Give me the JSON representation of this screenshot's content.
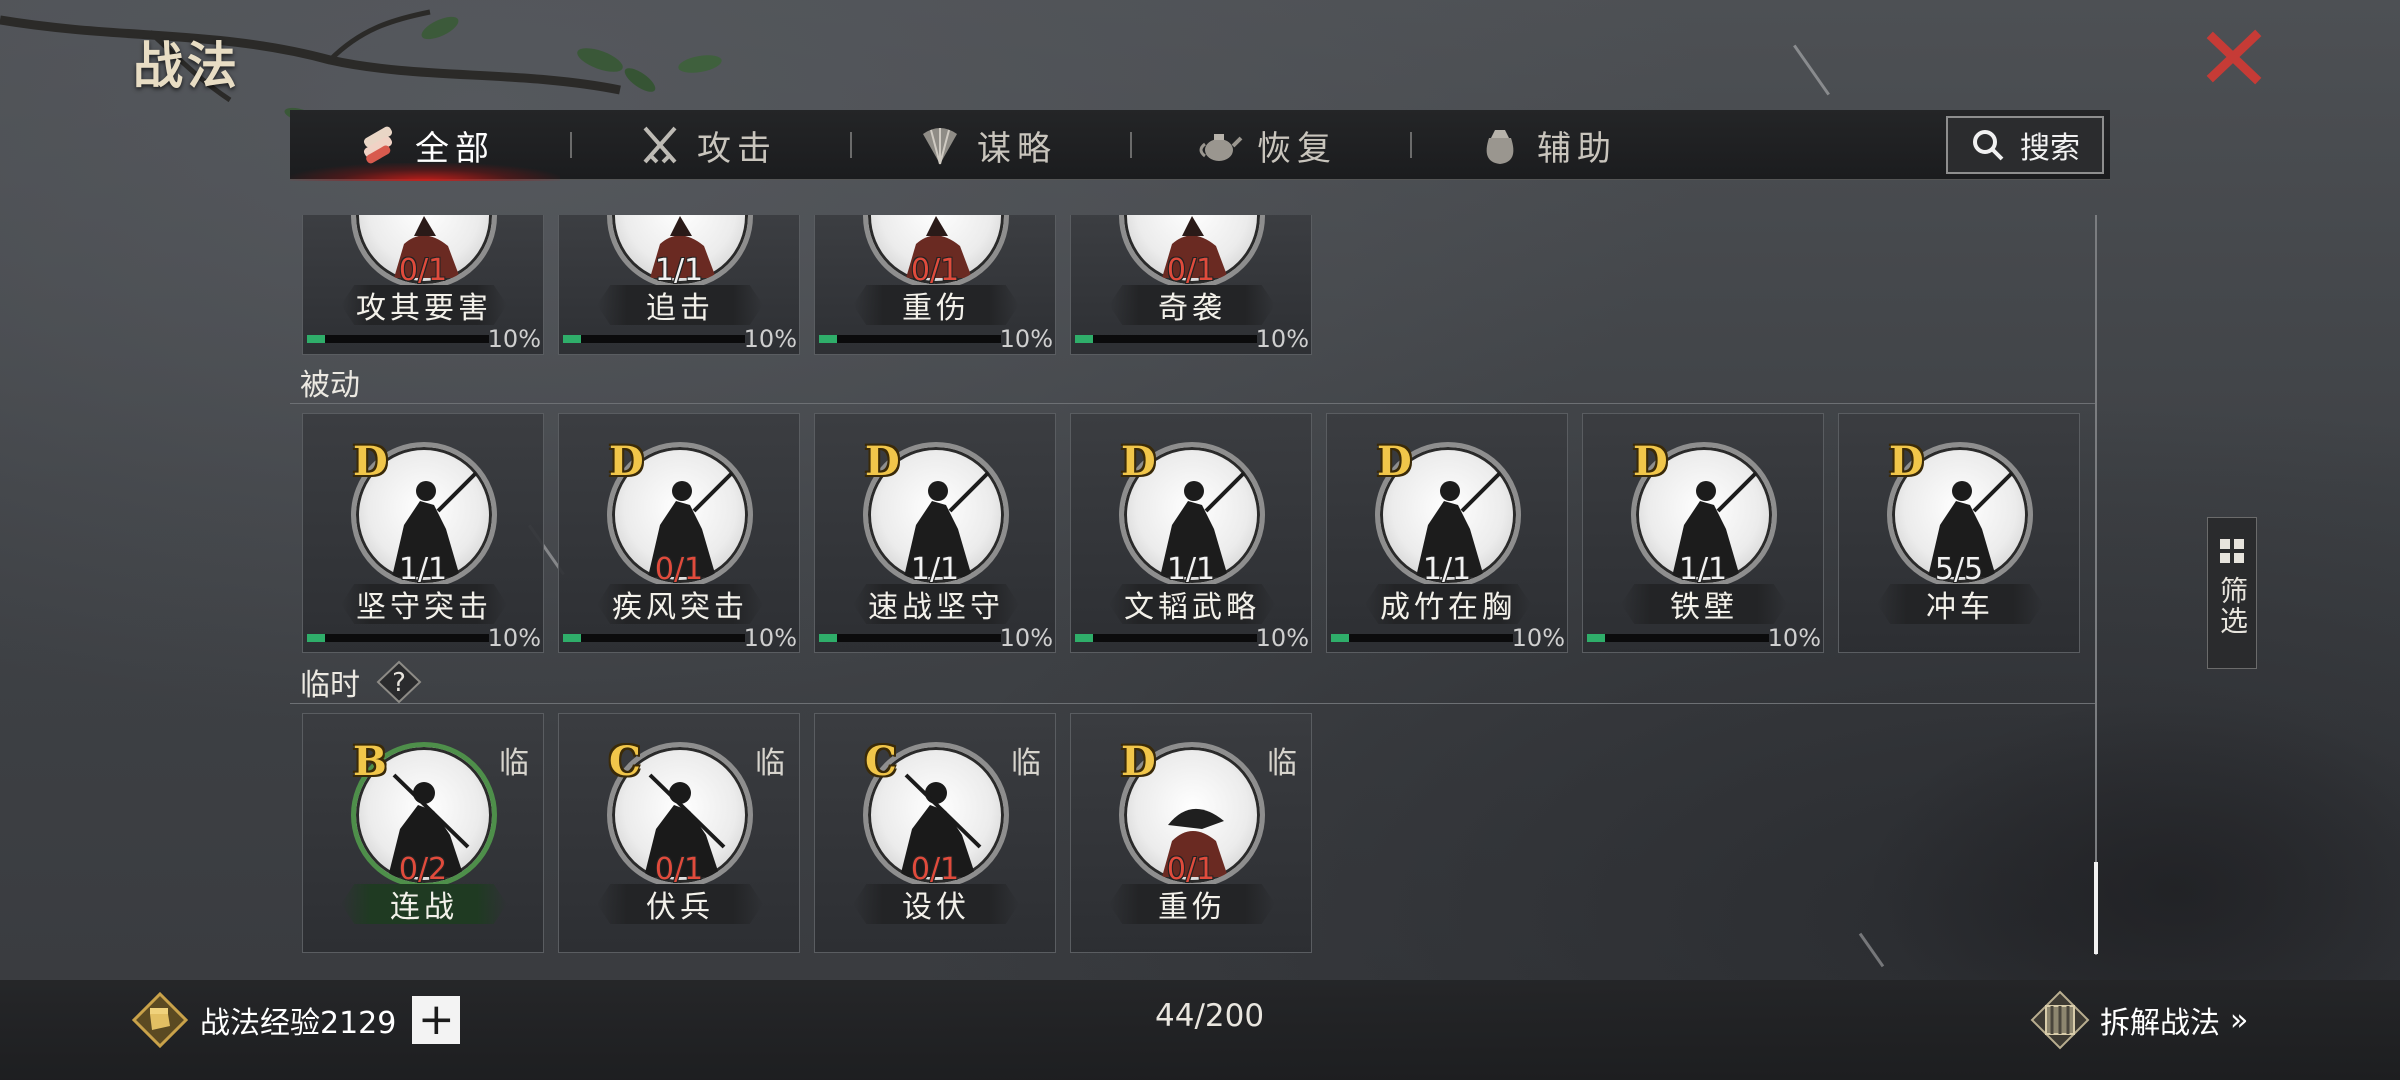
{
  "title": "战法",
  "tabs": [
    {
      "label": "全部",
      "icon": "scroll-bundle-icon",
      "active": true
    },
    {
      "label": "攻击",
      "icon": "crossed-swords-icon",
      "active": false
    },
    {
      "label": "谋略",
      "icon": "feather-fan-icon",
      "active": false
    },
    {
      "label": "恢复",
      "icon": "teapot-icon",
      "active": false
    },
    {
      "label": "辅助",
      "icon": "pouch-icon",
      "active": false
    }
  ],
  "search_label": "搜索",
  "partial_cards": [
    {
      "name": "攻其要害",
      "count": "0/1",
      "count_color": "red",
      "progress": "10%"
    },
    {
      "name": "追击",
      "count": "1/1",
      "count_color": "white",
      "progress": "10%"
    },
    {
      "name": "重伤",
      "count": "0/1",
      "count_color": "red",
      "progress": "10%"
    },
    {
      "name": "奇袭",
      "count": "0/1",
      "count_color": "red",
      "progress": "10%"
    }
  ],
  "sections": {
    "passive": {
      "label": "被动",
      "cards": [
        {
          "grade": "D",
          "name": "坚守突击",
          "count": "1/1",
          "count_color": "white",
          "progress": "10%"
        },
        {
          "grade": "D",
          "name": "疾风突击",
          "count": "0/1",
          "count_color": "red",
          "progress": "10%"
        },
        {
          "grade": "D",
          "name": "速战坚守",
          "count": "1/1",
          "count_color": "white",
          "progress": "10%"
        },
        {
          "grade": "D",
          "name": "文韬武略",
          "count": "1/1",
          "count_color": "white",
          "progress": "10%"
        },
        {
          "grade": "D",
          "name": "成竹在胸",
          "count": "1/1",
          "count_color": "white",
          "progress": "10%"
        },
        {
          "grade": "D",
          "name": "铁壁",
          "count": "1/1",
          "count_color": "white",
          "progress": "10%"
        },
        {
          "grade": "D",
          "name": "冲车",
          "count": "5/5",
          "count_color": "white",
          "progress": ""
        }
      ]
    },
    "temporary": {
      "label": "临时",
      "help_symbol": "?",
      "cards": [
        {
          "grade": "B",
          "tag": "临",
          "name": "连战",
          "count": "0/2",
          "count_color": "red",
          "highlight": "green"
        },
        {
          "grade": "C",
          "tag": "临",
          "name": "伏兵",
          "count": "0/1",
          "count_color": "red"
        },
        {
          "grade": "C",
          "tag": "临",
          "name": "设伏",
          "count": "0/1",
          "count_color": "red"
        },
        {
          "grade": "D",
          "tag": "临",
          "name": "重伤",
          "count": "0/1",
          "count_color": "red"
        }
      ]
    }
  },
  "filter_label": "筛选",
  "footer": {
    "exp_label": "战法经验2129",
    "plus_symbol": "+",
    "capacity": "44/200",
    "decompose_label": "拆解战法",
    "decompose_chevron": "»"
  },
  "colors": {
    "grade": "#f1c64a",
    "count_red": "#e04b3c",
    "progress_green": "#2fae6a",
    "active_tab_glow": "#c81e19",
    "close_red": "#c63b36"
  }
}
